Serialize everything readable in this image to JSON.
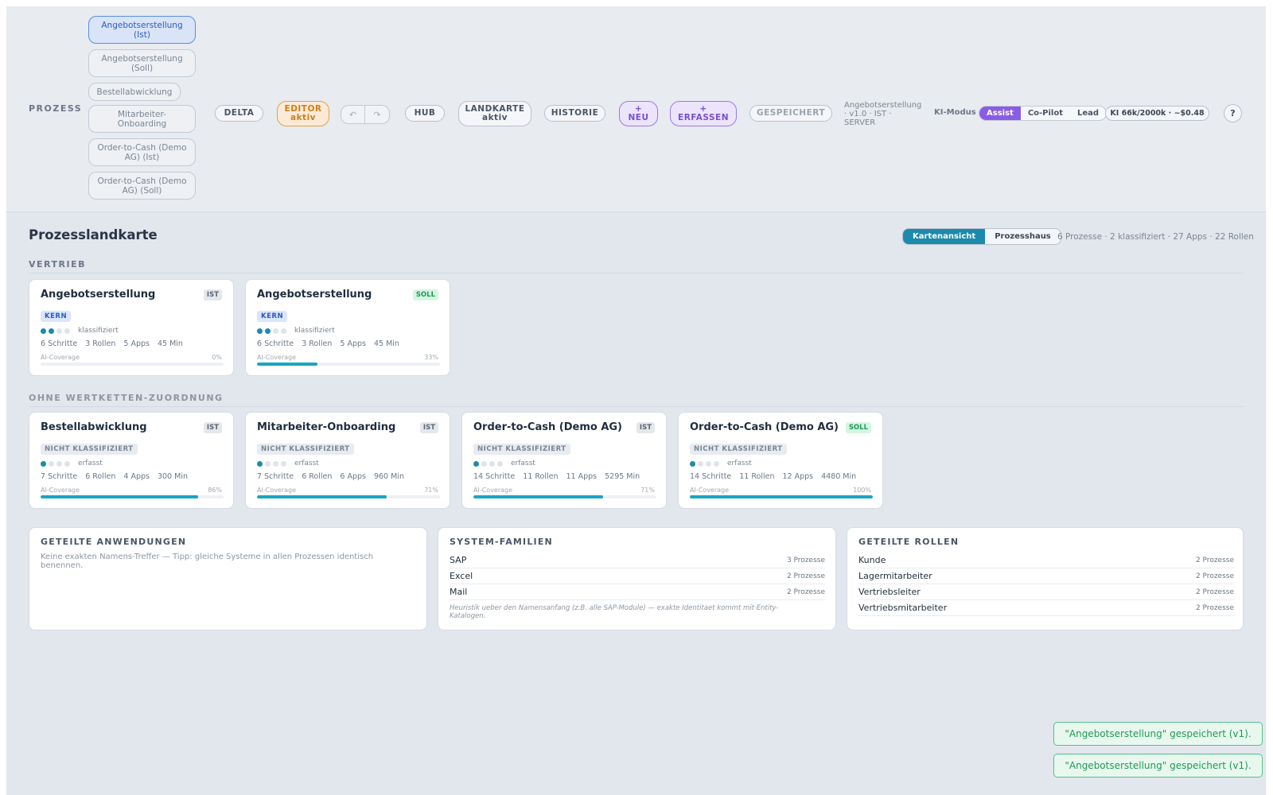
{
  "toolbar": {
    "prozess_label": "PROZESS",
    "processes": [
      {
        "label": "Angebotserstellung (Ist)",
        "active": true
      },
      {
        "label": "Angebotserstellung (Soll)",
        "active": false
      },
      {
        "label": "Bestellabwicklung",
        "active": false
      },
      {
        "label": "Mitarbeiter-Onboarding",
        "active": false
      },
      {
        "label": "Order-to-Cash (Demo AG) (Ist)",
        "active": false
      },
      {
        "label": "Order-to-Cash (Demo AG) (Soll)",
        "active": false
      }
    ],
    "delta": "DELTA",
    "editor_line1": "EDITOR",
    "editor_line2": "aktiv",
    "undo_icon": "↶",
    "redo_icon": "↷",
    "hub": "HUB",
    "landkarte_line1": "LANDKARTE",
    "landkarte_line2": "aktiv",
    "historie": "HISTORIE",
    "neu_line1": "+",
    "neu_line2": "NEU",
    "erfassen_line1": "+",
    "erfassen_line2": "ERFASSEN",
    "gespeichert": "GESPEICHERT",
    "version_text": "Angebotserstellung · v1.0 · IST · SERVER",
    "ki_modus_label": "KI-Modus",
    "ki_modes": [
      "Assist",
      "Co-Pilot",
      "Lead"
    ],
    "ki_mode_selected": "Assist",
    "ki_usage": "KI 66k/2000k · ~$0.48",
    "help": "?"
  },
  "main": {
    "title": "Prozesslandkarte",
    "view_tabs": [
      "Kartenansicht",
      "Prozesshaus"
    ],
    "view_selected": "Kartenansicht",
    "stats": "6 Prozesse · 2 klassifiziert · 27 Apps · 22 Rollen",
    "sections": [
      {
        "label": "VERTRIEB",
        "cards": [
          {
            "title": "Angebotserstellung",
            "badge": "IST",
            "class_label": "KERN",
            "dots_on": 2,
            "status": "klassifiziert",
            "steps": "6 Schritte",
            "roles": "3 Rollen",
            "apps": "5 Apps",
            "minutes": "45 Min",
            "coverage_label": "AI-Coverage",
            "coverage_text": "0%",
            "coverage": 0
          },
          {
            "title": "Angebotserstellung",
            "badge": "SOLL",
            "class_label": "KERN",
            "dots_on": 2,
            "status": "klassifiziert",
            "steps": "6 Schritte",
            "roles": "3 Rollen",
            "apps": "5 Apps",
            "minutes": "45 Min",
            "coverage_label": "AI-Coverage",
            "coverage_text": "33%",
            "coverage": 33
          }
        ]
      },
      {
        "label": "OHNE WERTKETTEN-ZUORDNUNG",
        "cards": [
          {
            "title": "Bestellabwicklung",
            "badge": "IST",
            "class_label": "NICHT KLASSIFIZIERT",
            "dots_on": 1,
            "status": "erfasst",
            "steps": "7 Schritte",
            "roles": "6 Rollen",
            "apps": "4 Apps",
            "minutes": "300 Min",
            "coverage_label": "AI-Coverage",
            "coverage_text": "86%",
            "coverage": 86
          },
          {
            "title": "Mitarbeiter-Onboarding",
            "badge": "IST",
            "class_label": "NICHT KLASSIFIZIERT",
            "dots_on": 1,
            "status": "erfasst",
            "steps": "7 Schritte",
            "roles": "6 Rollen",
            "apps": "6 Apps",
            "minutes": "960 Min",
            "coverage_label": "AI-Coverage",
            "coverage_text": "71%",
            "coverage": 71
          },
          {
            "title": "Order-to-Cash (Demo AG)",
            "badge": "IST",
            "class_label": "NICHT KLASSIFIZIERT",
            "dots_on": 1,
            "status": "erfasst",
            "steps": "14 Schritte",
            "roles": "11 Rollen",
            "apps": "11 Apps",
            "minutes": "5295 Min",
            "coverage_label": "AI-Coverage",
            "coverage_text": "71%",
            "coverage": 71
          },
          {
            "title": "Order-to-Cash (Demo AG)",
            "badge": "SOLL",
            "class_label": "NICHT KLASSIFIZIERT",
            "dots_on": 1,
            "status": "erfasst",
            "steps": "14 Schritte",
            "roles": "11 Rollen",
            "apps": "12 Apps",
            "minutes": "4480 Min",
            "coverage_label": "AI-Coverage",
            "coverage_text": "100%",
            "coverage": 100
          }
        ]
      }
    ],
    "panels": {
      "shared_apps": {
        "title": "GETEILTE ANWENDUNGEN",
        "note": "Keine exakten Namens-Treffer — Tipp: gleiche Systeme in allen Prozessen identisch benennen."
      },
      "system_families": {
        "title": "SYSTEM-FAMILIEN",
        "rows": [
          {
            "name": "SAP",
            "count": "3 Prozesse"
          },
          {
            "name": "Excel",
            "count": "2 Prozesse"
          },
          {
            "name": "Mail",
            "count": "2 Prozesse"
          }
        ],
        "footnote": "Heuristik ueber den Namensanfang (z.B. alle SAP-Module) — exakte Identitaet kommt mit Entity-Katalogen."
      },
      "shared_roles": {
        "title": "GETEILTE ROLLEN",
        "rows": [
          {
            "name": "Kunde",
            "count": "2 Prozesse"
          },
          {
            "name": "Lagermitarbeiter",
            "count": "2 Prozesse"
          },
          {
            "name": "Vertriebsleiter",
            "count": "2 Prozesse"
          },
          {
            "name": "Vertriebsmitarbeiter",
            "count": "2 Prozesse"
          }
        ]
      }
    }
  },
  "toasts": [
    "\"Angebotserstellung\" gespeichert (v1).",
    "\"Angebotserstellung\" gespeichert (v1)."
  ],
  "colors": {
    "accent_teal": "#1b8aad",
    "coverage_bar": "#17a6c4",
    "ki_purple": "#8a5ce6",
    "editor_orange": "#d07d1a",
    "soll_green": "#1f9a55"
  }
}
